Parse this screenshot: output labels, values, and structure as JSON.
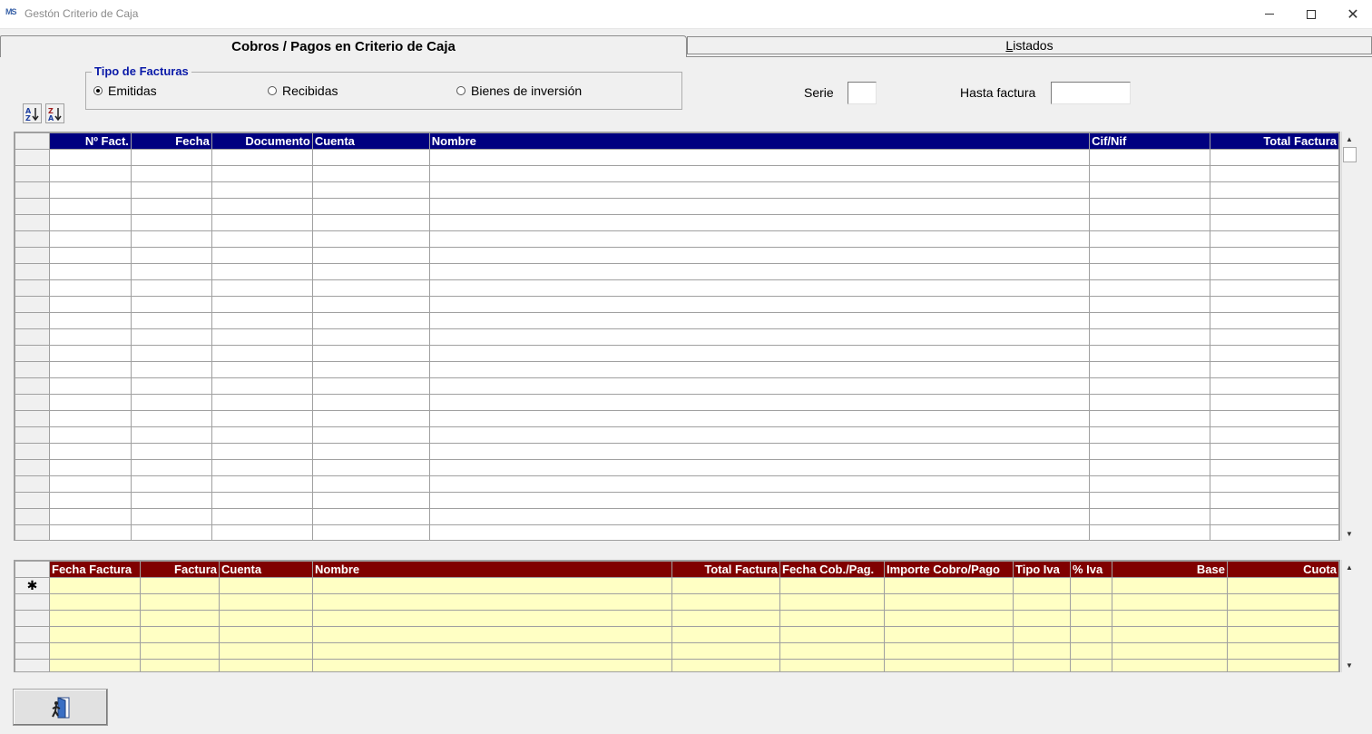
{
  "window": {
    "title": "Gestón Criterio de Caja",
    "app_icon_text": "MS"
  },
  "tabs": [
    {
      "label": "Cobros / Pagos en Criterio de Caja",
      "active": true
    },
    {
      "label": "Listados",
      "active": false
    }
  ],
  "tipo_facturas": {
    "legend": "Tipo de Facturas",
    "options": [
      {
        "label": "Emitidas",
        "checked": true
      },
      {
        "label": "Recibidas",
        "checked": false
      },
      {
        "label": "Bienes de inversión",
        "checked": false
      }
    ]
  },
  "filters": {
    "serie_label": "Serie",
    "serie_value": "",
    "hasta_label": "Hasta factura",
    "hasta_value": ""
  },
  "sort_buttons": [
    {
      "icon": "sort-ascending-icon",
      "glyph": "A Z"
    },
    {
      "icon": "sort-descending-icon",
      "glyph": "Z A"
    }
  ],
  "facturas_grid": {
    "columns": [
      "Nº Fact.",
      "Fecha",
      "Documento",
      "Cuenta",
      "Nombre",
      "Cif/Nif",
      "Total Factura"
    ],
    "row_count": 24
  },
  "detalle_grid": {
    "columns": [
      "Fecha Factura",
      "Factura",
      "Cuenta",
      "Nombre",
      "Total Factura",
      "Fecha Cob./Pag.",
      "Importe Cobro/Pago",
      "Tipo Iva",
      "% Iva",
      "Base",
      "Cuota"
    ],
    "new_row_marker": "✱",
    "row_count": 6
  },
  "colors": {
    "header_blue": "#000080",
    "header_maroon": "#800000",
    "detail_row_bg": "#ffffc4",
    "legend_text": "#0a1aa8"
  },
  "exit_button": {
    "icon": "exit-door-icon"
  }
}
